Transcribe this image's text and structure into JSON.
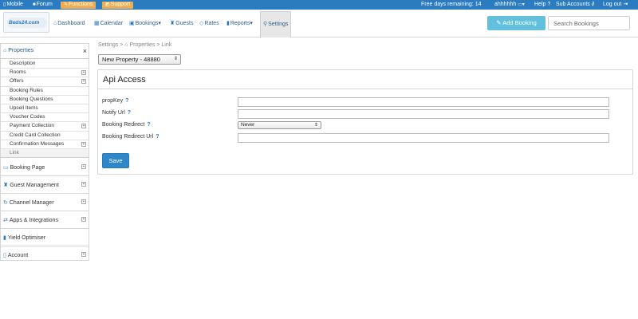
{
  "topbar": {
    "mobile": "Mobile",
    "forum": "Forum",
    "functions": "Functions",
    "support": "Support",
    "free_days": "Free days remaining:  14",
    "user": "ahhhhhh",
    "help": "Help",
    "sub_accounts": "Sub Accounts",
    "logout": "Log out",
    "bar_color": "#2b7bc0",
    "badge_color": "#f0ad4e"
  },
  "logo": {
    "text": "Beds24.com"
  },
  "nav": {
    "dashboard": "Dashboard",
    "calendar": "Calendar",
    "bookings": "Bookings",
    "guests": "Guests",
    "rates": "Rates",
    "reports": "Reports",
    "settings": "Settings"
  },
  "header": {
    "add_booking": "Add Booking",
    "search_placeholder": "Search Bookings",
    "accent": "#62c0dc"
  },
  "sidebar": {
    "title": "Properties",
    "items": [
      {
        "label": "Description"
      },
      {
        "label": "Rooms"
      },
      {
        "label": "Offers"
      },
      {
        "label": "Booking Rules"
      },
      {
        "label": "Booking Questions"
      },
      {
        "label": "Upsell Items"
      },
      {
        "label": "Voucher Codes"
      },
      {
        "label": "Payment Collection"
      },
      {
        "label": "Credit Card Collection"
      },
      {
        "label": "Confirmation Messages"
      },
      {
        "label": "Link"
      }
    ],
    "sections": [
      {
        "label": "Booking Page"
      },
      {
        "label": "Guest Management"
      },
      {
        "label": "Channel Manager"
      },
      {
        "label": "Apps & Integrations"
      },
      {
        "label": "Yield Optimiser"
      },
      {
        "label": "Account"
      }
    ]
  },
  "breadcrumb": {
    "settings": "Settings",
    "sep1": ">",
    "properties": "Properties",
    "sep2": ">",
    "link": "Link"
  },
  "property_select": {
    "value": "New Property - 48880"
  },
  "panel": {
    "title": "Api Access",
    "fields": {
      "propkey": {
        "label": "propKey",
        "help": "?",
        "value": ""
      },
      "notify_url": {
        "label": "Notify Url",
        "help": "?",
        "value": ""
      },
      "booking_redirect": {
        "label": "Booking Redirect",
        "help": "?",
        "value": "Never"
      },
      "booking_redirect_url": {
        "label": "Booking Redirect Url",
        "help": "?",
        "value": ""
      }
    },
    "save": "Save",
    "save_color": "#2e87c8"
  }
}
